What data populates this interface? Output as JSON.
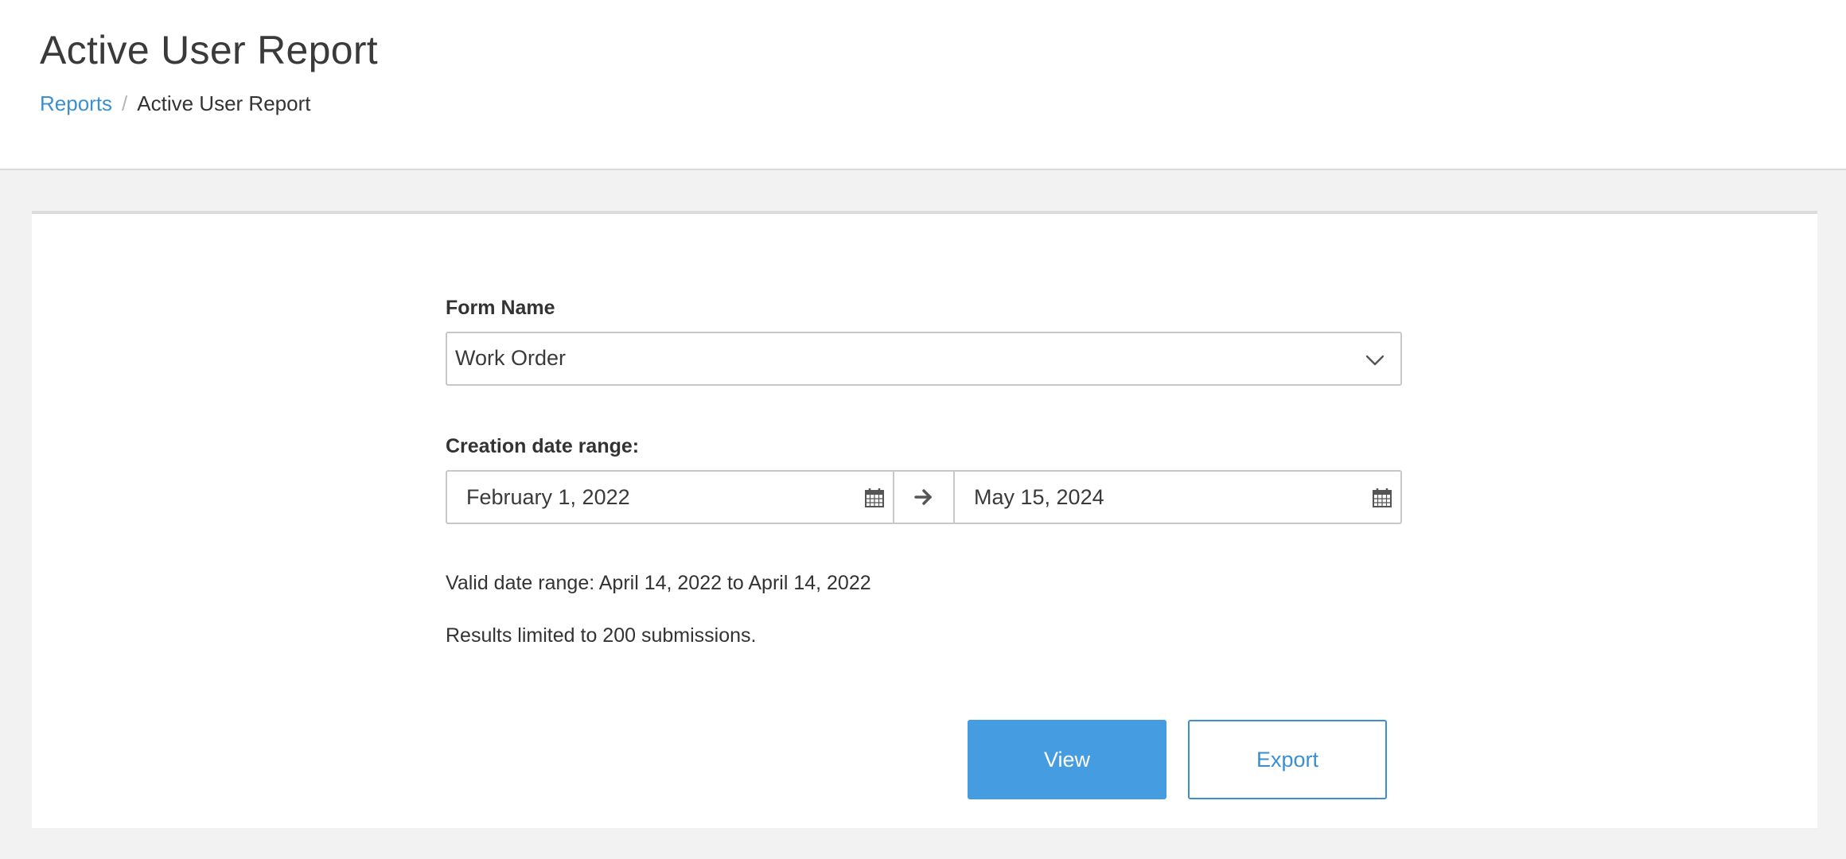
{
  "header": {
    "title": "Active User Report",
    "breadcrumb": {
      "parent": "Reports",
      "separator": "/",
      "current": "Active User Report"
    }
  },
  "form": {
    "form_name": {
      "label": "Form Name",
      "selected": "Work Order",
      "icon": "chevron-down-icon"
    },
    "date_range": {
      "label": "Creation date range:",
      "start": "February 1, 2022",
      "end": "May 15, 2024",
      "start_icon": "calendar-icon",
      "end_icon": "calendar-icon",
      "separator_icon": "arrow-right-icon"
    },
    "valid_range_text": "Valid date range: April 14, 2022 to April 14, 2022",
    "limit_text": "Results limited to 200 submissions."
  },
  "actions": {
    "view_label": "View",
    "export_label": "Export"
  },
  "colors": {
    "accent": "#469ce0",
    "link": "#3b8fd0",
    "background": "#f2f2f2"
  }
}
